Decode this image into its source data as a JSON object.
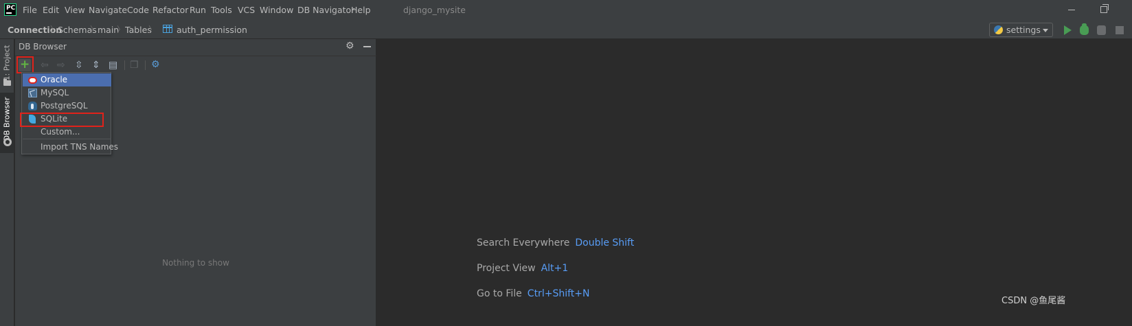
{
  "menubar": {
    "logo_text": "PC",
    "items": [
      "File",
      "Edit",
      "View",
      "Navigate",
      "Code",
      "Refactor",
      "Run",
      "Tools",
      "VCS",
      "Window",
      "DB Navigator",
      "Help"
    ],
    "project_title": "django_mysite"
  },
  "breadcrumb": {
    "items": [
      "Connection",
      "Schemas",
      "main",
      "Tables",
      "auth_permission"
    ]
  },
  "run_toolbar": {
    "config_label": "settings"
  },
  "tool_windows": {
    "project": "1: Project",
    "db_browser": "DB Browser"
  },
  "db_panel": {
    "title": "DB Browser",
    "empty_text": "Nothing to show"
  },
  "add_connection_menu": {
    "items": [
      "Oracle",
      "MySQL",
      "PostgreSQL",
      "SQLite",
      "Custom...",
      "Import TNS Names"
    ],
    "selected": "Oracle"
  },
  "editor_hints": [
    {
      "action": "Search Everywhere",
      "shortcut": "Double Shift"
    },
    {
      "action": "Project View",
      "shortcut": "Alt+1"
    },
    {
      "action": "Go to File",
      "shortcut": "Ctrl+Shift+N"
    }
  ],
  "watermark": "CSDN @鱼尾酱",
  "colors": {
    "background": "#2b2b2b",
    "panel": "#3c3f41",
    "selection": "#4b6eaf",
    "highlight_box": "#e1221a",
    "shortcut_text": "#589df6",
    "run_green": "#499c54"
  }
}
